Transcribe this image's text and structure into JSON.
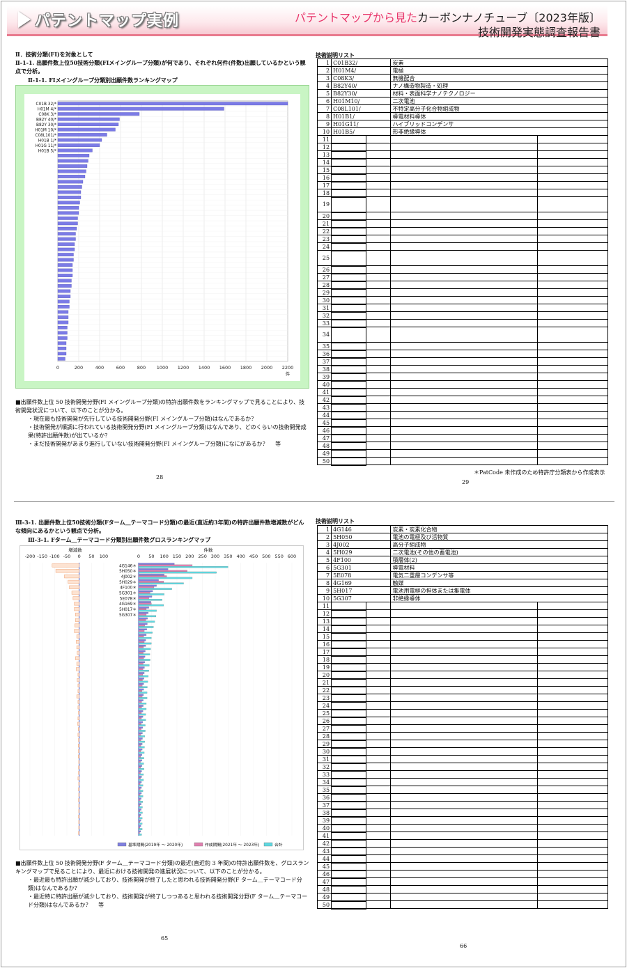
{
  "header": {
    "title": "パテントマップ実例",
    "subtitle_pink": "パテントマップから見た",
    "subtitle_main": "カーボンナノチューブ〔2023年版〕",
    "report": "技術開発実態調査報告書"
  },
  "top_left": {
    "section": "Ⅱ．技術分類(FI)を対象として",
    "heading": "Ⅱ-1-1. 出願件数上位50技術分類(FIメイングループ分類)が何であり、それぞれ何件(件数)出願しているかという観点で分析。",
    "chart_title": "Ⅱ-1-1. FIメイングループ分類別出願件数ランキングマップ",
    "body_intro": "■出願件数上位 50 技術開発分野(FI メイングループ分類)の特許出願件数をランキングマップで見ることにより、技術開発状況について、以下のことが分かる。",
    "body_b1": "・現在最も技術開発が先行している技術開発分野(FI メイングループ分類)はなんであるか？",
    "body_b2": "・技術開発が順調に行われている技術開発分野(FI メイングループ分類)はなんであり、どのくらいの技術開発成果(特許出願件数)が出ているか？",
    "body_b3": "・まだ技術開発があまり進行していない技術開発分野(FI メイングループ分類)になにがあるか？　 等",
    "page_no": "28"
  },
  "top_right": {
    "table_title": "技術説明リスト",
    "note": "＊PatCode 未作成のため特許庁分類表から作成表示",
    "page_no": "29",
    "rows": [
      {
        "no": "1",
        "code": "C01B32/",
        "desc": "炭素"
      },
      {
        "no": "2",
        "code": "H01M4/",
        "desc": "電極"
      },
      {
        "no": "3",
        "code": "C08K3/",
        "desc": "無機配合"
      },
      {
        "no": "4",
        "code": "B82Y40/",
        "desc": "ナノ構造物製造・処理"
      },
      {
        "no": "5",
        "code": "B82Y30/",
        "desc": "材料・表面科学ナノテクノロジー"
      },
      {
        "no": "6",
        "code": "H01M10/",
        "desc": "二次電池"
      },
      {
        "no": "7",
        "code": "C08L101/",
        "desc": "不特定高分子化合物組成物"
      },
      {
        "no": "8",
        "code": "H01B1/",
        "desc": "導電材料導体"
      },
      {
        "no": "9",
        "code": "H01G11/",
        "desc": "ハイブリッドコンデンサ"
      },
      {
        "no": "10",
        "code": "H01B5/",
        "desc": "形非絶縁導体"
      }
    ]
  },
  "bottom_left": {
    "heading": "Ⅲ-3-1. 出願件数上位50技術分類(Fターム＿テーマコード分類)の最近(直近約3年間)の特許出願件数増減数がどんな傾向にあるかという観点で分析。",
    "chart_title": "Ⅲ-3-1. Fターム＿テーマコード分類別出願件数グロスランキングマップ",
    "body_intro": "■出願件数上位 50 技術開発分野(F ターム＿テーマコード分類)の最近(直近約 3 年間)の特許出願件数を、グロスランキングマップで見ることにより、最近における技術開発の進展状況について、以下のことが分かる。",
    "body_b1": "・最近最も特許出願が減少しており、技術開発が終了したと思われる技術開発分野(F ターム＿テーマコード分類)はなんであるか？",
    "body_b2": "・最近特に特許出願が減少しており、技術開発が終了しつつあると思われる技術開発分野(F ターム＿テーマコード分類)はなんであるか？　 等",
    "page_no": "65"
  },
  "bottom_right": {
    "table_title": "技術説明リスト",
    "page_no": "66",
    "rows": [
      {
        "no": "1",
        "code": "4G146",
        "desc": "炭素・炭素化合物"
      },
      {
        "no": "2",
        "code": "5H050",
        "desc": "電池の電極及び活物質"
      },
      {
        "no": "3",
        "code": "4J002",
        "desc": "高分子組成物"
      },
      {
        "no": "4",
        "code": "5H029",
        "desc": "二次電池(その他の蓄電池)"
      },
      {
        "no": "5",
        "code": "4F100",
        "desc": "積層体(2)"
      },
      {
        "no": "6",
        "code": "5G301",
        "desc": "導電材料"
      },
      {
        "no": "7",
        "code": "5E078",
        "desc": "電気二重層コンデンサ等"
      },
      {
        "no": "8",
        "code": "4G169",
        "desc": "触媒"
      },
      {
        "no": "9",
        "code": "5H017",
        "desc": "電池用電極の担体または集電体"
      },
      {
        "no": "10",
        "code": "5G307",
        "desc": "非絶縁導体"
      }
    ]
  },
  "chart_data": [
    {
      "type": "bar",
      "orientation": "horizontal",
      "title": "",
      "xlabel": "件",
      "xlim": [
        0,
        2200
      ],
      "xticks": [
        0,
        200,
        400,
        600,
        800,
        1000,
        1200,
        1400,
        1600,
        1800,
        2000,
        2200
      ],
      "color": "#7b7be6",
      "categories": [
        "C01B 32/*",
        "H01M 4/*",
        "C08K 3/*",
        "B82Y 40/*",
        "B82Y 30/*",
        "H01M 10/*",
        "C08L101/*",
        "H01B 1/*",
        "H01G 11/*",
        "H01B 5/*"
      ],
      "values": [
        2200,
        1590,
        780,
        590,
        580,
        550,
        470,
        420,
        400,
        330,
        300,
        290,
        280,
        270,
        260,
        240,
        230,
        220,
        220,
        210,
        200,
        200,
        190,
        190,
        180,
        170,
        170,
        160,
        160,
        150,
        150,
        140,
        140,
        140,
        130,
        130,
        120,
        120,
        110,
        110,
        100,
        100,
        100,
        90,
        90,
        90,
        80,
        80,
        80,
        70
      ]
    },
    {
      "type": "bar",
      "orientation": "horizontal",
      "title": "増減数",
      "xlim": [
        -200,
        100
      ],
      "xticks": [
        -200,
        -150,
        -100,
        -50,
        0,
        50,
        100
      ],
      "color": "#f0a070",
      "values": [
        -110,
        -95,
        -60,
        -45,
        -40,
        -30,
        -25,
        -20,
        -20,
        -15,
        -15,
        -18,
        -20,
        -10,
        -12,
        -10,
        -8,
        -15,
        -10,
        -12,
        -5,
        -8,
        -5,
        -5,
        -10,
        -5,
        -5,
        -3,
        -5,
        -6,
        -4,
        -5,
        -3,
        -4,
        -3,
        -4,
        -2,
        -3,
        -3,
        -5,
        -2,
        -3,
        -2,
        -3,
        -2,
        -2,
        -3,
        -2,
        -2,
        -3
      ]
    },
    {
      "type": "bar",
      "orientation": "horizontal",
      "title": "件数",
      "xlim": [
        0,
        600
      ],
      "xticks": [
        0,
        50,
        100,
        150,
        200,
        250,
        300,
        350,
        400,
        450,
        500,
        550,
        600
      ],
      "categories": [
        "4G146＊",
        "5H050＊",
        "4J002＊",
        "5H029＊",
        "4F100＊",
        "5G301＊",
        "5E078＊",
        "4G169＊",
        "5H017＊",
        "5G307＊"
      ],
      "series": [
        {
          "name": "基準期間(2019年 ～ 2020年)",
          "color": "#8080e0",
          "values": [
            140,
            115,
            100,
            78,
            70,
            55,
            52,
            48,
            40,
            38,
            35,
            34,
            32,
            30,
            28,
            28,
            26,
            25,
            24,
            23,
            22,
            21,
            20,
            20,
            19,
            18,
            18,
            17,
            17,
            16,
            16,
            15,
            15,
            14,
            14,
            13,
            13,
            13,
            12,
            12,
            11,
            11,
            11,
            10,
            10,
            10,
            9,
            9,
            9,
            8
          ]
        },
        {
          "name": "作成期間(2021年 ～ 2023年)",
          "color": "#e080b0",
          "values": [
            210,
            190,
            110,
            98,
            60,
            45,
            40,
            50,
            30,
            30,
            28,
            24,
            22,
            20,
            22,
            19,
            18,
            20,
            18,
            17,
            16,
            15,
            14,
            13,
            14,
            12,
            12,
            11,
            11,
            10,
            10,
            9,
            9,
            9,
            8,
            8,
            7,
            8,
            7,
            7,
            6,
            6,
            6,
            6,
            5,
            5,
            5,
            5,
            5,
            4
          ]
        },
        {
          "name": "合計",
          "color": "#60d8e0",
          "values": [
            350,
            305,
            210,
            176,
            130,
            100,
            92,
            98,
            70,
            68,
            63,
            58,
            54,
            50,
            50,
            47,
            44,
            45,
            42,
            40,
            38,
            36,
            34,
            33,
            33,
            30,
            30,
            28,
            28,
            26,
            26,
            24,
            24,
            23,
            22,
            21,
            20,
            21,
            19,
            19,
            17,
            17,
            17,
            16,
            15,
            15,
            14,
            14,
            14,
            12
          ]
        }
      ]
    }
  ]
}
